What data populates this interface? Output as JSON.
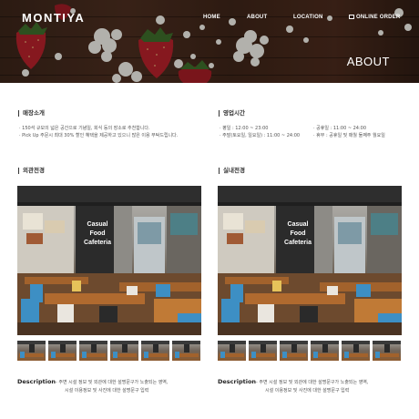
{
  "brand": {
    "logo": "MONTIYA"
  },
  "nav": {
    "items": [
      "HOME",
      "ABOUT",
      "LOCATION"
    ],
    "order_label": "ONLINE ORDER"
  },
  "hero": {
    "title": "ABOUT"
  },
  "store_intro": {
    "title": "매장소개",
    "lines": [
      "· 150석 규모의 넓은 공간으로 기념일, 회식 등의 장소로 추천합니다.",
      "· Pick Up 주문시 최대 30% 할인 혜택을 제공하고 있으니 많은 이용 부탁드립니다."
    ]
  },
  "hours": {
    "title": "영업시간",
    "left": [
      "· 평일 : 12:00 ~ 23:00",
      "· 주말(토요일, 일요일) : 11:00 ~ 24:00"
    ],
    "right": [
      "· 공휴일 : 11:00 ~ 24:00",
      "· 휴무 : 공휴일 및 매월 둘째주 월요일"
    ]
  },
  "exterior": {
    "title": "외관전경",
    "sign_lines": [
      "Casual",
      "Food",
      "Cafeteria"
    ],
    "description_label": "Description",
    "description_lines": [
      "-  주변 시설 정보 및 외관에 대한 설명문구가 노출되는 영역,",
      "시설 이용정보 및 사진에 대한 설명문구 입력"
    ]
  },
  "interior": {
    "title": "실내전경",
    "sign_lines": [
      "Casual",
      "Food",
      "Cafeteria"
    ],
    "description_label": "Description",
    "description_lines": [
      "-  주변 시설 정보 및 외관에 대한 설명문구가 노출되는 영역,",
      "시설 이용정보 및 사진에 대한 설명문구 입력"
    ]
  },
  "colors": {
    "hero_wood": "#3a2419",
    "strawberry": "#b3202a",
    "flower": "#f0efe8",
    "sign_bg": "#2b2b2b",
    "chair_blue": "#3d8fc4",
    "table_wood": "#a2622c"
  },
  "icons": {
    "cart": "cart-icon"
  }
}
